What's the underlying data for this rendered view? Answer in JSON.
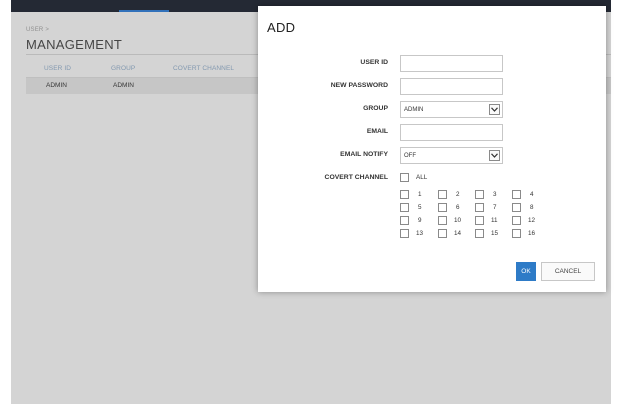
{
  "header": {
    "breadcrumb": "USER >",
    "title": "MANAGEMENT"
  },
  "table": {
    "columns": [
      "USER ID",
      "GROUP",
      "COVERT CHANNEL"
    ],
    "rows": [
      {
        "user_id": "ADMIN",
        "group": "ADMIN"
      }
    ]
  },
  "dialog": {
    "title": "ADD",
    "fields": {
      "user_id_label": "USER ID",
      "new_password_label": "NEW PASSWORD",
      "group_label": "GROUP",
      "group_value": "ADMIN",
      "email_label": "EMAIL",
      "email_notify_label": "EMAIL NOTIFY",
      "email_notify_value": "OFF",
      "covert_channel_label": "COVERT CHANNEL",
      "all_label": "ALL"
    },
    "channels": [
      "1",
      "2",
      "3",
      "4",
      "5",
      "6",
      "7",
      "8",
      "9",
      "10",
      "11",
      "12",
      "13",
      "14",
      "15",
      "16"
    ],
    "ok_label": "OK",
    "cancel_label": "CANCEL"
  },
  "colors": {
    "accent": "#2e7bc7",
    "topbar": "#1e2430"
  }
}
